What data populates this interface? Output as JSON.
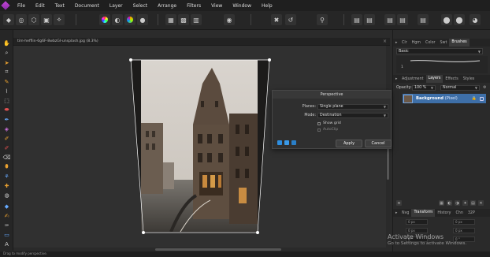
{
  "menubar": {
    "items": [
      "File",
      "Edit",
      "Text",
      "Document",
      "Layer",
      "Select",
      "Arrange",
      "Filters",
      "View",
      "Window",
      "Help"
    ]
  },
  "document": {
    "tab_title": "tim-hefflin-6g6F-8wbzGI-unsplash.jpg (8.3%)",
    "close_label": "×"
  },
  "right_panel": {
    "top_tabs": [
      "Clr",
      "Hgm",
      "Color",
      "Swt",
      "Brushes"
    ],
    "active_top_tab": "Brushes",
    "brush_category": "Basic",
    "brush_size_label": "1",
    "layer_tabs": [
      "Adjustment",
      "Layers",
      "Effects",
      "Styles"
    ],
    "active_layer_tab": "Layers",
    "opacity_label": "Opacity:",
    "opacity_value": "100 %",
    "blend_mode": "Normal",
    "layer": {
      "name": "Background",
      "type": "(Pixel)"
    },
    "bottom_tabs": [
      "Nvg",
      "Transform",
      "History",
      "Chn",
      "32P"
    ],
    "active_bottom_tab": "Transform",
    "transform_fields": [
      "0 px",
      "0 px",
      "0 px",
      "0 px",
      "0 °",
      "0 °"
    ]
  },
  "dialog": {
    "title": "Perspective",
    "planes_label": "Planes:",
    "planes_value": "Single plane",
    "mode_label": "Mode:",
    "mode_value": "Destination",
    "show_grid_label": "Show grid",
    "autoclip_label": "AutoClip",
    "apply_label": "Apply",
    "cancel_label": "Cancel"
  },
  "watermark": {
    "title": "Activate Windows",
    "subtitle": "Go to Settings to activate Windows."
  },
  "status": {
    "text": "Drag to modify perspective."
  }
}
